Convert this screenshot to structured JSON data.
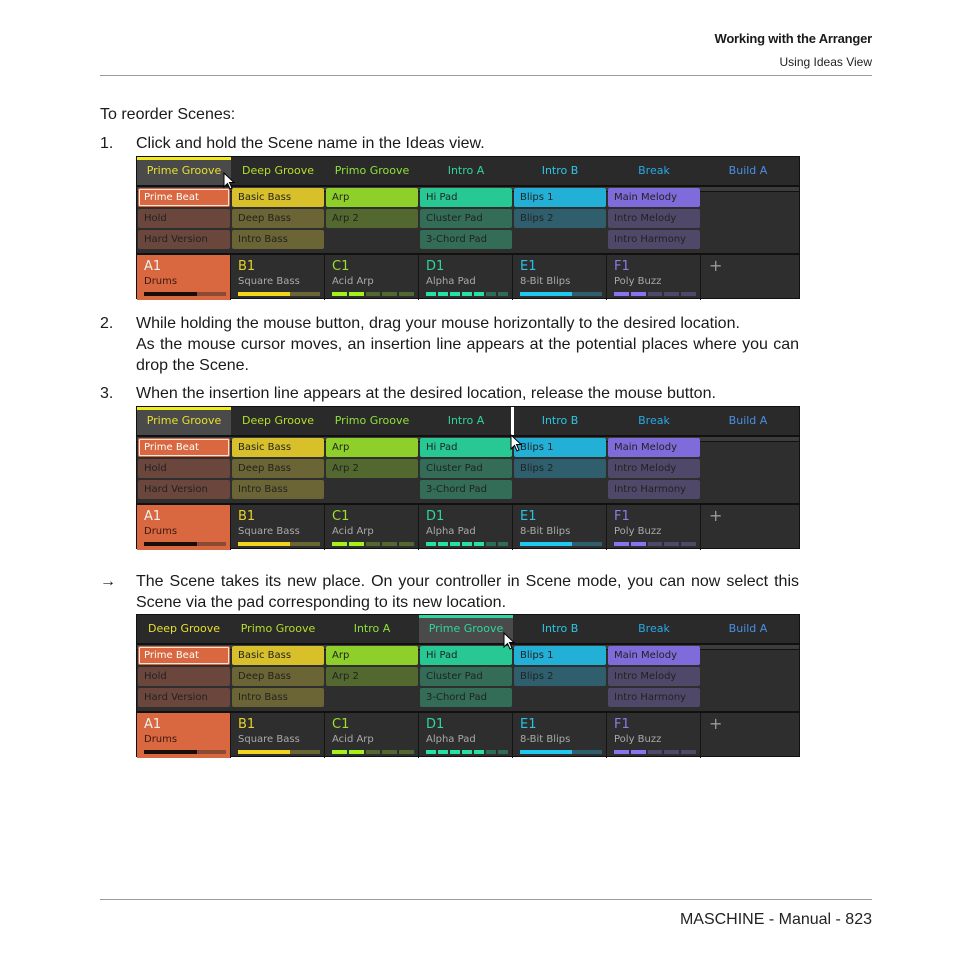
{
  "header": {
    "chapter": "Working with the Arranger",
    "section": "Using Ideas View"
  },
  "footer": {
    "text": "MASCHINE - Manual - 823"
  },
  "intro": "To reorder Scenes:",
  "steps": [
    {
      "num": "1.",
      "text": "Click and hold the Scene name in the Ideas view."
    },
    {
      "num": "2.",
      "line1": "While holding the mouse button, drag your mouse horizontally to the desired location.",
      "line2": "As the mouse cursor moves, an insertion line appears at the potential places where you can drop the Scene."
    },
    {
      "num": "3.",
      "text": "When the insertion line appears at the desired location, release the mouse button."
    }
  ],
  "result": {
    "arrow": "→",
    "text": "The Scene takes its new place. On your controller in Scene mode, you can now select this Scene via the pad corresponding to its new location."
  },
  "colors": {
    "orange": "#d9673f",
    "yellow": "#d7c02a",
    "lime": "#8fcf2a",
    "teal": "#27c893",
    "cyan": "#22b0d6",
    "purple": "#7f6bd9",
    "blue": "#4a8fe0"
  },
  "panels": [
    {
      "tabs": [
        {
          "label": "Prime Groove",
          "color": "#e6e030",
          "selected": true,
          "bar": "#f2ec1a"
        },
        {
          "label": "Deep Groove",
          "color": "#b3e02a"
        },
        {
          "label": "Primo Groove",
          "color": "#8ee23a"
        },
        {
          "label": "Intro A",
          "color": "#2ed5a0"
        },
        {
          "label": "Intro B",
          "color": "#2cc6e6"
        },
        {
          "label": "Break",
          "color": "#2aa8e8"
        },
        {
          "label": "Build A",
          "color": "#4a8fe6"
        }
      ],
      "cursor_on": "tab-0",
      "insertion_line": false
    },
    {
      "tabs": [
        {
          "label": "Prime Groove",
          "color": "#e6e030",
          "selected": true,
          "bar": "#f2ec1a"
        },
        {
          "label": "Deep Groove",
          "color": "#b3e02a"
        },
        {
          "label": "Primo Groove",
          "color": "#8ee23a"
        },
        {
          "label": "Intro A",
          "color": "#2ed5a0"
        },
        {
          "label": "Intro B",
          "color": "#2cc6e6"
        },
        {
          "label": "Break",
          "color": "#2aa8e8"
        },
        {
          "label": "Build A",
          "color": "#4a8fe6"
        }
      ],
      "cursor_on": "insertion-line",
      "insertion_line": true
    },
    {
      "tabs": [
        {
          "label": "Deep Groove",
          "color": "#e6e030"
        },
        {
          "label": "Primo Groove",
          "color": "#b3e02a"
        },
        {
          "label": "Intro A",
          "color": "#8ee23a"
        },
        {
          "label": "Prime Groove",
          "color": "#2ed5a0",
          "selected": true,
          "bar": "#2ed5a0"
        },
        {
          "label": "Intro B",
          "color": "#2cc6e6"
        },
        {
          "label": "Break",
          "color": "#2aa8e8"
        },
        {
          "label": "Build A",
          "color": "#4a8fe6"
        }
      ],
      "cursor_on": "tab-3",
      "insertion_line": false
    }
  ],
  "clips": [
    [
      {
        "label": "Prime Beat",
        "bg": "#d9673f",
        "light": true,
        "outline": true
      },
      {
        "label": "Hold",
        "bg": "#6a463d"
      },
      {
        "label": "Hard Version",
        "bg": "#6a463d"
      }
    ],
    [
      {
        "label": "Basic Bass",
        "bg": "#d7c02a"
      },
      {
        "label": "Deep Bass",
        "bg": "#6b6434"
      },
      {
        "label": "Intro Bass",
        "bg": "#6b6434"
      }
    ],
    [
      {
        "label": "Arp",
        "bg": "#8fcf2a"
      },
      {
        "label": "Arp 2",
        "bg": "#53682e"
      },
      null
    ],
    [
      {
        "label": "Hi Pad",
        "bg": "#27c893"
      },
      {
        "label": "Cluster Pad",
        "bg": "#336c57"
      },
      {
        "label": "3-Chord Pad",
        "bg": "#336c57"
      }
    ],
    [
      {
        "label": "Blips 1",
        "bg": "#22b0d6"
      },
      {
        "label": "Blips 2",
        "bg": "#2f5f6d"
      },
      null
    ],
    [
      {
        "label": "Main Melody",
        "bg": "#7f6bd9"
      },
      {
        "label": "Intro Melody",
        "bg": "#4f4868"
      },
      {
        "label": "Intro Harmony",
        "bg": "#4f4868"
      }
    ]
  ],
  "groups": [
    {
      "id": "A1",
      "name": "Drums",
      "color": "#f0f0f0",
      "bg": "#d9673f",
      "sub": "#3a1a10",
      "meter": {
        "on": "#1a0d08",
        "off": "#8a4a34",
        "level": 0.65,
        "segments": 1
      }
    },
    {
      "id": "B1",
      "name": "Square Bass",
      "color": "#e6d02a",
      "meter": {
        "on": "#f2d51f",
        "off": "#6b6434",
        "level": 0.63,
        "segments": 1
      }
    },
    {
      "id": "C1",
      "name": "Acid Arp",
      "color": "#9be02a",
      "meter": {
        "on": "#a4f21a",
        "off": "#53682e",
        "level": 0.4,
        "segments": 5
      }
    },
    {
      "id": "D1",
      "name": "Alpha Pad",
      "color": "#2ed5a0",
      "meter": {
        "on": "#27e0a6",
        "off": "#2f6b57",
        "level": 0.72,
        "segments": 7
      }
    },
    {
      "id": "E1",
      "name": "8-Bit Blips",
      "color": "#2cc0e6",
      "meter": {
        "on": "#21c8f0",
        "off": "#2f5f6d",
        "level": 0.64,
        "segments": 1
      }
    },
    {
      "id": "F1",
      "name": "Poly Buzz",
      "color": "#8f7ae6",
      "meter": {
        "on": "#8a72f0",
        "off": "#4f4868",
        "level": 0.4,
        "segments": 5
      }
    }
  ],
  "add_group_label": "+"
}
